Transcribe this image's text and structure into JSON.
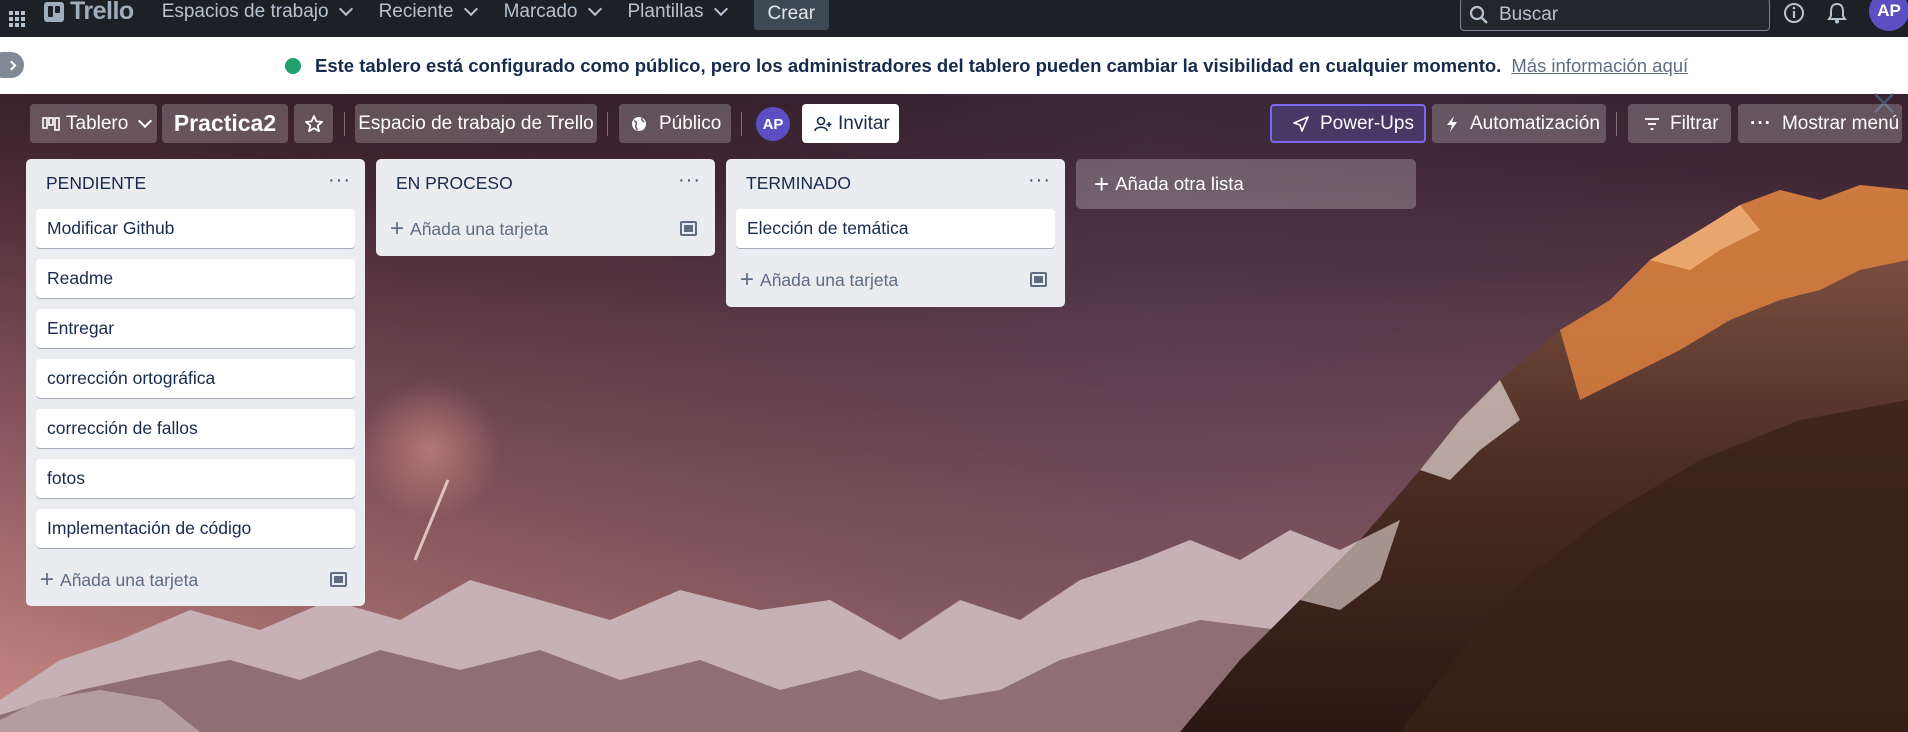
{
  "topnav": {
    "logo_text": "Trello",
    "menus": [
      "Espacios de trabajo",
      "Reciente",
      "Marcado",
      "Plantillas"
    ],
    "create_label": "Crear",
    "search_placeholder": "Buscar",
    "avatar_initials": "AP"
  },
  "banner": {
    "message": "Este tablero está configurado como público, pero los administradores del tablero pueden cambiar la visibilidad en cualquier momento.",
    "link": "Más información aquí"
  },
  "board_header": {
    "view_label": "Tablero",
    "board_name": "Practica2",
    "workspace_label": "Espacio de trabajo de Trello",
    "visibility_label": "Público",
    "member_initials": "AP",
    "invite_label": "Invitar",
    "powerups_label": "Power-Ups",
    "automation_label": "Automatización",
    "filter_label": "Filtrar",
    "menu_label": "Mostrar menú"
  },
  "lists": [
    {
      "title": "PENDIENTE",
      "cards": [
        "Modificar Github",
        "Readme",
        "Entregar",
        "corrección ortográfica",
        "corrección de fallos",
        "fotos",
        "Implementación de código"
      ],
      "add_card_label": "Añada una tarjeta"
    },
    {
      "title": "EN PROCESO",
      "cards": [],
      "add_card_label": "Añada una tarjeta"
    },
    {
      "title": "TERMINADO",
      "cards": [
        "Elección de temática"
      ],
      "add_card_label": "Añada una tarjeta"
    }
  ],
  "add_list_label": "Añada otra lista",
  "colors": {
    "nav_bg": "#1d2125",
    "list_bg": "#ebecf0",
    "powerups_border": "#7b68ee",
    "banner_icon": "#22a06b"
  }
}
